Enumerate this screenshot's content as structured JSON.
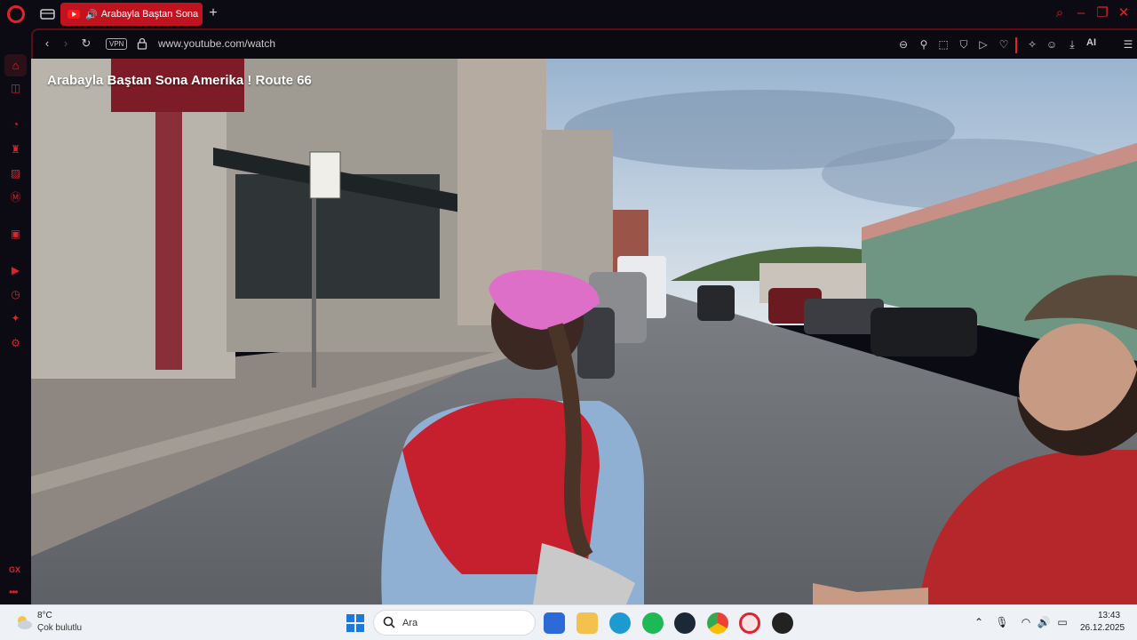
{
  "browser": {
    "tab": {
      "title": "Arabayla Baştan Sona"
    },
    "address": {
      "vpn_label": "VPN",
      "url": "www.youtube.com/watch"
    },
    "ai_label": "AI",
    "sidebar_gx": "GX"
  },
  "video": {
    "title": "Arabayla Baştan Sona Amerika ! Route 66"
  },
  "taskbar": {
    "weather": {
      "temp": "8°C",
      "condition": "Çok bulutlu"
    },
    "search_placeholder": "Ara",
    "clock": {
      "time": "13:43",
      "date": "26.12.2025"
    }
  },
  "colors": {
    "accent": "#e0222f",
    "tab_active": "#c1121f",
    "taskbar_bg": "#eef2f7"
  }
}
